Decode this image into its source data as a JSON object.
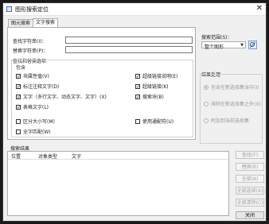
{
  "window": {
    "title": "图形搜索定位",
    "close_label": "✕"
  },
  "tabs": [
    {
      "label": "图元搜索"
    },
    {
      "label": "文字搜索"
    }
  ],
  "search": {
    "find_label": "查找字符串(I)：",
    "find_value": "",
    "replace_label": "替换字符串(P)：",
    "replace_value": ""
  },
  "options": {
    "group_label": "查找和替换选项",
    "include_label": "包含",
    "items": [
      {
        "label": "块属性值(V)",
        "checked": true
      },
      {
        "label": "超级链接说明(E)",
        "checked": true
      },
      {
        "label": "标注注释文字(D)",
        "checked": true
      },
      {
        "label": "超级链接(K)",
        "checked": true
      },
      {
        "label": "文字（多行文字、动态文字、文字）(X)",
        "checked": true
      },
      {
        "label": "搜索块(B)",
        "checked": true
      },
      {
        "label": "表格文字(L)",
        "checked": true
      }
    ],
    "extra": [
      {
        "label": "区分大小写(M)",
        "checked": false
      },
      {
        "label": "使用通配符(U)",
        "checked": false
      },
      {
        "label": "全字匹配(W)",
        "checked": false
      }
    ]
  },
  "scope": {
    "label": "搜索范围(S)：",
    "value": "整个图形",
    "icon": "select-objects-icon"
  },
  "result_handling": {
    "label": "结果处理",
    "items": [
      {
        "label": "包含在新选择集当中(I)",
        "selected": true
      },
      {
        "label": "排除在新选择集之外(X)",
        "selected": false
      },
      {
        "label": "附加到当前选择集",
        "selected": false
      }
    ]
  },
  "results": {
    "label": "搜索结果",
    "columns": [
      "位置",
      "对象类型",
      "文字"
    ]
  },
  "buttons": {
    "find": "查找(F)",
    "replace": "替换(R)",
    "replace_all": "全部(A)",
    "select_all": "全部选择(X)",
    "deselect_all": "全部清除(C)",
    "close": "关闭"
  },
  "colors": {
    "accent": "#4a72b0",
    "disabled_text": "#a0a0a0"
  }
}
